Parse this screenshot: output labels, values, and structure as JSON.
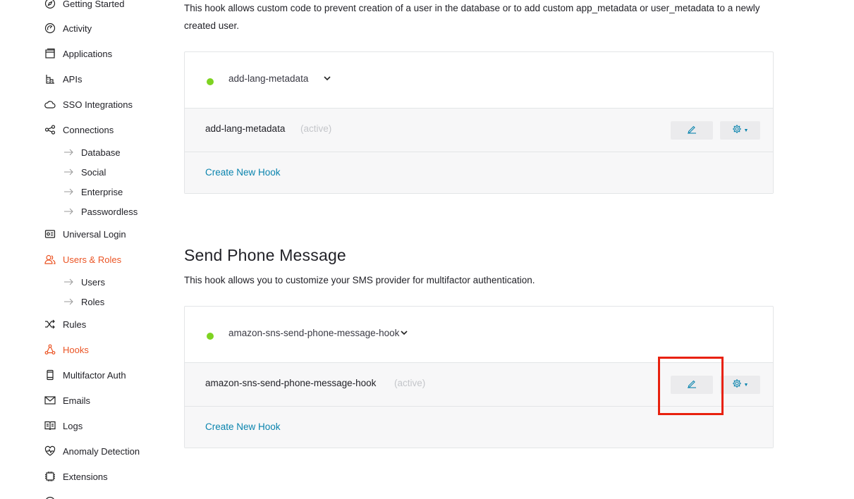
{
  "sidebar": {
    "items": [
      {
        "label": "Getting Started",
        "icon": "compass-icon"
      },
      {
        "label": "Activity",
        "icon": "activity-icon"
      },
      {
        "label": "Applications",
        "icon": "applications-icon"
      },
      {
        "label": "APIs",
        "icon": "apis-icon"
      },
      {
        "label": "SSO Integrations",
        "icon": "cloud-icon"
      },
      {
        "label": "Connections",
        "icon": "connections-icon"
      },
      {
        "label": "Universal Login",
        "icon": "universal-login-icon"
      },
      {
        "label": "Users & Roles",
        "icon": "users-icon"
      },
      {
        "label": "Rules",
        "icon": "rules-icon"
      },
      {
        "label": "Hooks",
        "icon": "hooks-icon"
      },
      {
        "label": "Multifactor Auth",
        "icon": "phone-icon"
      },
      {
        "label": "Emails",
        "icon": "mail-icon"
      },
      {
        "label": "Logs",
        "icon": "logs-icon"
      },
      {
        "label": "Anomaly Detection",
        "icon": "heart-icon"
      },
      {
        "label": "Extensions",
        "icon": "extensions-icon"
      }
    ],
    "connections_sub": [
      "Database",
      "Social",
      "Enterprise",
      "Passwordless"
    ],
    "users_sub": [
      "Users",
      "Roles"
    ],
    "accent_color": "#eb5424"
  },
  "section1": {
    "description": "This hook allows custom code to prevent creation of a user in the database or to add custom app_metadata or user_metadata to a newly created user.",
    "selected_hook": "add-lang-metadata",
    "row_name": "add-lang-metadata",
    "row_status": "(active)",
    "create_link": "Create New Hook"
  },
  "section2": {
    "title": "Send Phone Message",
    "description": "This hook allows you to customize your SMS provider for multifactor authentication.",
    "selected_hook": "amazon-sns-send-phone-message-hook",
    "row_name": "amazon-sns-send-phone-message-hook",
    "row_status": "(active)",
    "create_link": "Create New Hook"
  },
  "colors": {
    "link": "#0a84ae",
    "status_active": "#7ed321",
    "highlight": "#e8210f"
  }
}
